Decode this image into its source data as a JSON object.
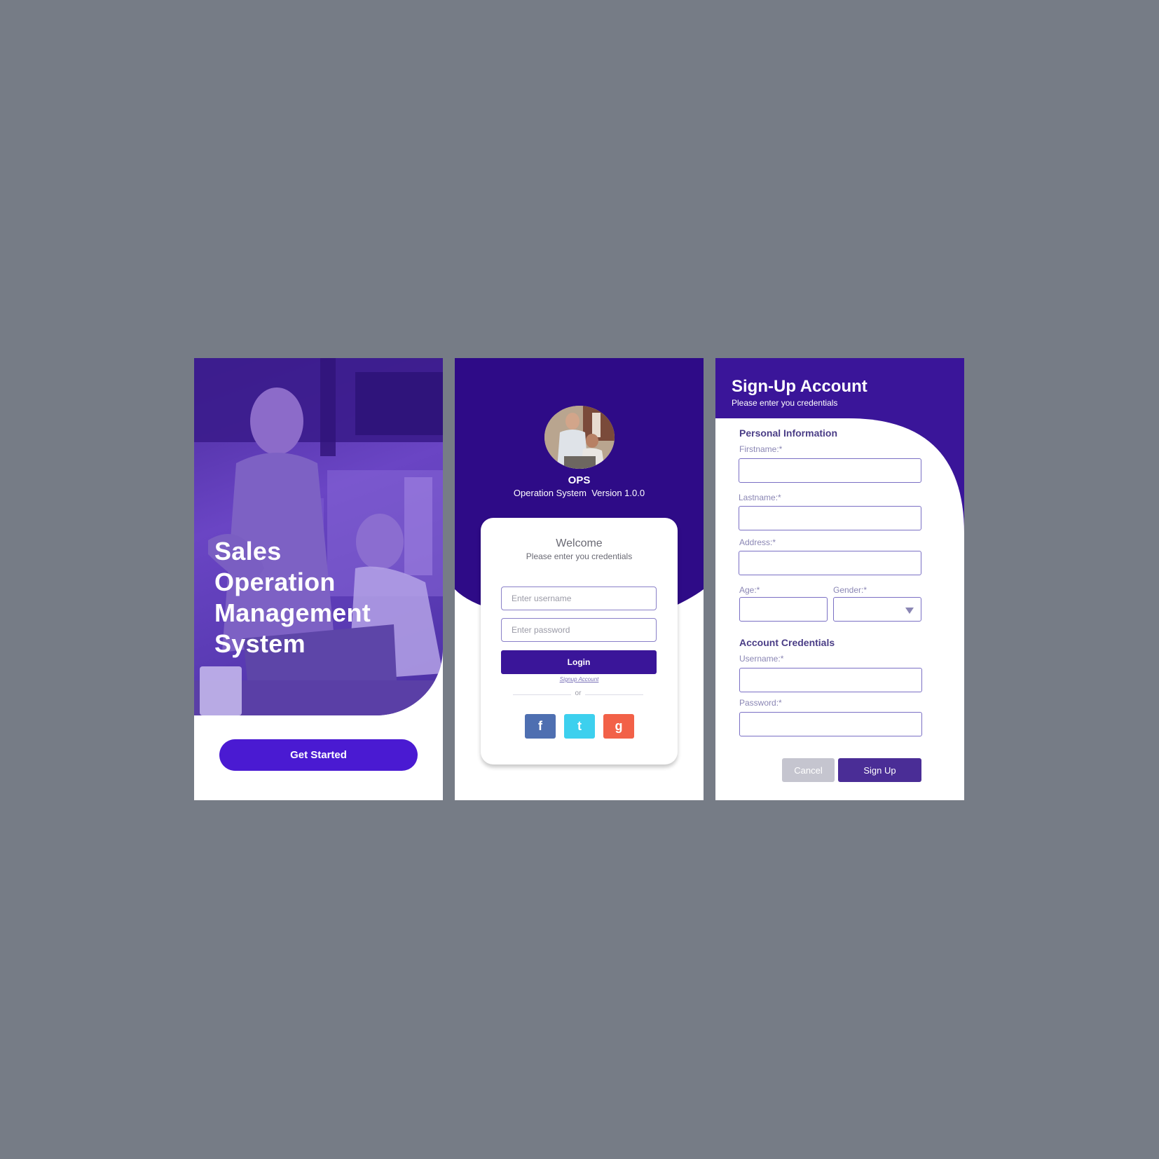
{
  "screen1": {
    "title_lines": [
      "Sales",
      "Operation",
      "Management",
      "System"
    ],
    "get_started_label": "Get Started"
  },
  "screen2": {
    "app_name": "OPS",
    "app_version": "Operation System  Version 1.0.0",
    "welcome": "Welcome",
    "welcome_sub": "Please enter you credentials",
    "username_placeholder": "Enter username",
    "password_placeholder": "Enter password",
    "login_label": "Login",
    "signup_link": "Signup Account",
    "or_text": "or",
    "social": {
      "facebook": "f",
      "twitter": "t",
      "google": "g"
    }
  },
  "screen3": {
    "title": "Sign-Up Account",
    "subtitle": "Please enter you credentials",
    "personal_section": "Personal Information",
    "firstname_label": "Firstname:*",
    "lastname_label": "Lastname:*",
    "address_label": "Address:*",
    "age_label": "Age:*",
    "gender_label": "Gender:*",
    "account_section": "Account Credentials",
    "username_label": "Username:*",
    "password_label": "Password:*",
    "cancel_label": "Cancel",
    "signup_label": "Sign Up"
  },
  "colors": {
    "background": "#767c86",
    "primary": "#2e0b87",
    "button": "#4a1ad2",
    "facebook": "#4e6fb1",
    "twitter": "#3dd0ee",
    "google": "#f26148"
  }
}
